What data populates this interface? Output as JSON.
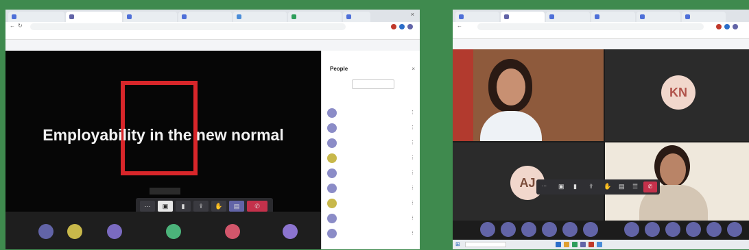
{
  "left_window": {
    "tabs": [
      "",
      "",
      "",
      "",
      "",
      "",
      ""
    ],
    "active_tab": 1,
    "address": "",
    "bookmarks": [
      "",
      "",
      ""
    ],
    "slide": {
      "title": "Employability in the new normal",
      "subtitle": "",
      "subtitle2": "",
      "shot_label": ""
    },
    "recording_label": "",
    "people_panel": {
      "title": "People",
      "invite_label": "",
      "section_label": "",
      "participants": [
        "",
        "",
        "",
        "",
        "",
        "",
        "",
        "",
        ""
      ]
    },
    "participant_strip": [
      {
        "initials": "",
        "name": "",
        "color": "#6264a7"
      },
      {
        "initials": "",
        "name": "",
        "color": "#c8b84a"
      },
      {
        "initials": "",
        "name": "",
        "color": "#7a6ac0"
      },
      {
        "initials": "",
        "name": "",
        "color": "#4bb37a"
      },
      {
        "initials": "",
        "name": "",
        "color": "#d2566b"
      },
      {
        "initials": "",
        "name": "",
        "color": "#8c74cf"
      }
    ]
  },
  "right_window": {
    "tabs": [
      "",
      "",
      "",
      "",
      "",
      ""
    ],
    "address": "",
    "tiles": [
      {
        "name": ""
      },
      {
        "name": "",
        "initials": "KN"
      },
      {
        "name": "",
        "initials": "AJ"
      },
      {
        "name": ""
      }
    ],
    "search_placeholder": ""
  },
  "colors": {
    "background": "#3f8a4e",
    "teams_purple": "#6264a7",
    "end_call_red": "#c4314b",
    "slide_frame_red": "#d8262a"
  }
}
